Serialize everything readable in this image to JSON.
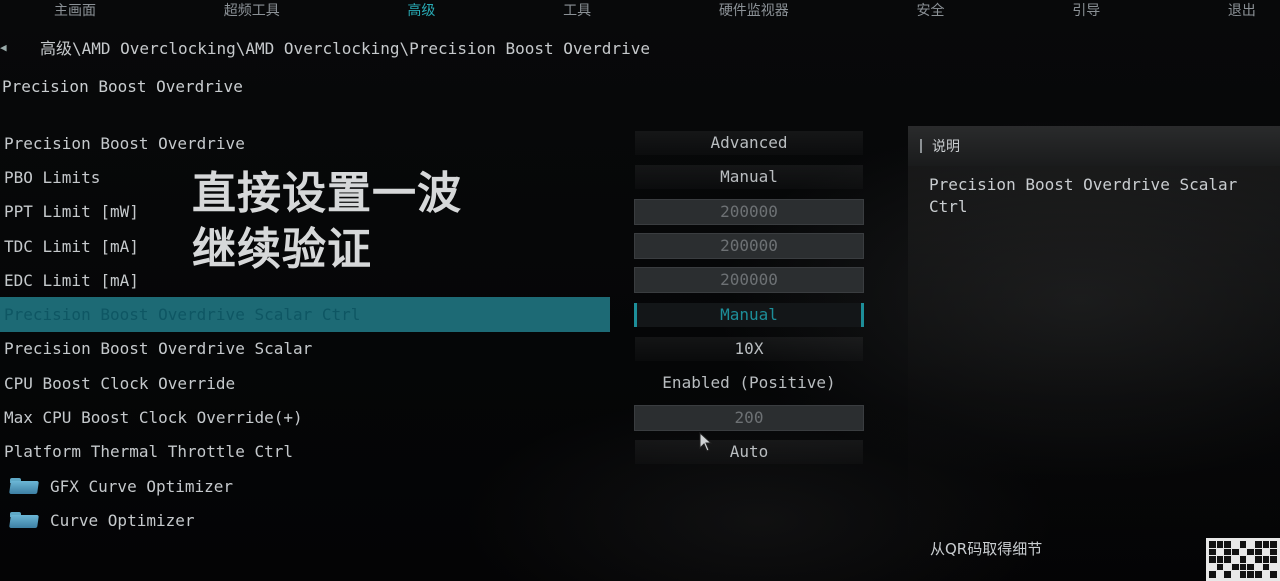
{
  "topbar": {
    "tabs": [
      {
        "label": "主画面",
        "active": false
      },
      {
        "label": "超频工具",
        "active": false
      },
      {
        "label": "高级",
        "active": true
      },
      {
        "label": "工具",
        "active": false
      },
      {
        "label": "硬件监视器",
        "active": false
      },
      {
        "label": "安全",
        "active": false
      },
      {
        "label": "引导",
        "active": false
      },
      {
        "label": "退出",
        "active": false
      }
    ]
  },
  "breadcrumb": "高级\\AMD Overclocking\\AMD Overclocking\\Precision Boost Overdrive",
  "page_title": "Precision Boost Overdrive",
  "settings": [
    {
      "label": "Precision Boost Overdrive",
      "value": "Advanced"
    },
    {
      "label": "PBO Limits",
      "value": "Manual"
    },
    {
      "label": "PPT Limit [mW]",
      "value": "200000"
    },
    {
      "label": "TDC Limit [mA]",
      "value": "200000"
    },
    {
      "label": "EDC Limit [mA]",
      "value": "200000"
    },
    {
      "label": "Precision Boost Overdrive Scalar Ctrl",
      "value": "Manual"
    },
    {
      "label": "Precision Boost Overdrive Scalar",
      "value": "10X"
    },
    {
      "label": "CPU Boost Clock Override",
      "value": "Enabled (Positive)"
    },
    {
      "label": "Max CPU Boost Clock Override(+)",
      "value": "200"
    },
    {
      "label": "Platform Thermal Throttle Ctrl",
      "value": "Auto"
    }
  ],
  "folders": [
    {
      "label": "GFX Curve Optimizer"
    },
    {
      "label": "Curve Optimizer"
    }
  ],
  "overlay_caption": {
    "line1": "直接设置一波",
    "line2": "继续验证"
  },
  "help_panel": {
    "title": "说明",
    "text": "Precision Boost Overdrive Scalar Ctrl",
    "qr_hint": "从QR码取得细节"
  },
  "colors": {
    "accent": "#28a9b3",
    "selected_row": "#1d6a75"
  }
}
